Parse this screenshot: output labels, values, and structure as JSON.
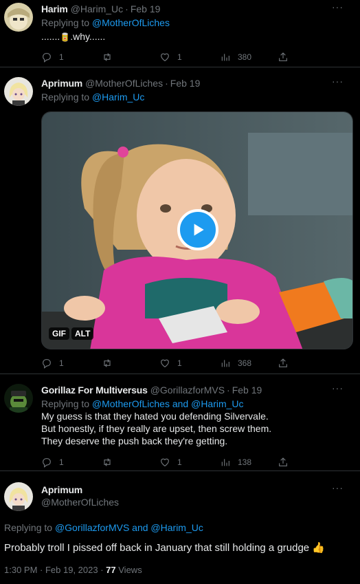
{
  "tweets": [
    {
      "name": "Harim",
      "handle": "@Harim_Uc",
      "date": "Feb 19",
      "reply_prefix": "Replying to",
      "reply_to": "@MotherOfLiches",
      "text_before": ".......",
      "text_emoji": "🥫",
      "text_after": ".why......",
      "stats": {
        "replies": "1",
        "retweets": "",
        "likes": "1",
        "views": "380"
      }
    },
    {
      "name": "Aprimum",
      "handle": "@MotherOfLiches",
      "date": "Feb 19",
      "reply_prefix": "Replying to",
      "reply_to": "@Harim_Uc",
      "media_badges": [
        "GIF",
        "ALT"
      ],
      "stats": {
        "replies": "1",
        "retweets": "",
        "likes": "1",
        "views": "368"
      }
    },
    {
      "name": "Gorillaz For Multiversus",
      "handle": "@GorillazforMVS",
      "date": "Feb 19",
      "reply_prefix": "Replying to",
      "reply_to": "@MotherOfLiches and @Harim_Uc",
      "lines": [
        "My guess is that they hated you defending Silvervale.",
        "But honestly, if they really are upset, then screw them.",
        "They deserve the push back they're getting."
      ],
      "stats": {
        "replies": "1",
        "retweets": "",
        "likes": "1",
        "views": "138"
      }
    }
  ],
  "focus": {
    "name": "Aprimum",
    "handle": "@MotherOfLiches",
    "reply_prefix": "Replying to",
    "reply_to": "@GorillazforMVS and @Harim_Uc",
    "text": "Probably troll I pissed off back in January that still holding a grudge 👍",
    "time": "1:30 PM · Feb 19, 2023 ·",
    "views_count": "77",
    "views_label": "Views"
  },
  "icons": [
    "reply-icon",
    "retweet-icon",
    "like-icon",
    "views-icon",
    "share-icon",
    "more-icon",
    "play-icon"
  ],
  "colors": {
    "background": "#000000",
    "text": "#e7e9ea",
    "muted": "#71767b",
    "link": "#1d9bf0",
    "divider": "#2f3336"
  }
}
